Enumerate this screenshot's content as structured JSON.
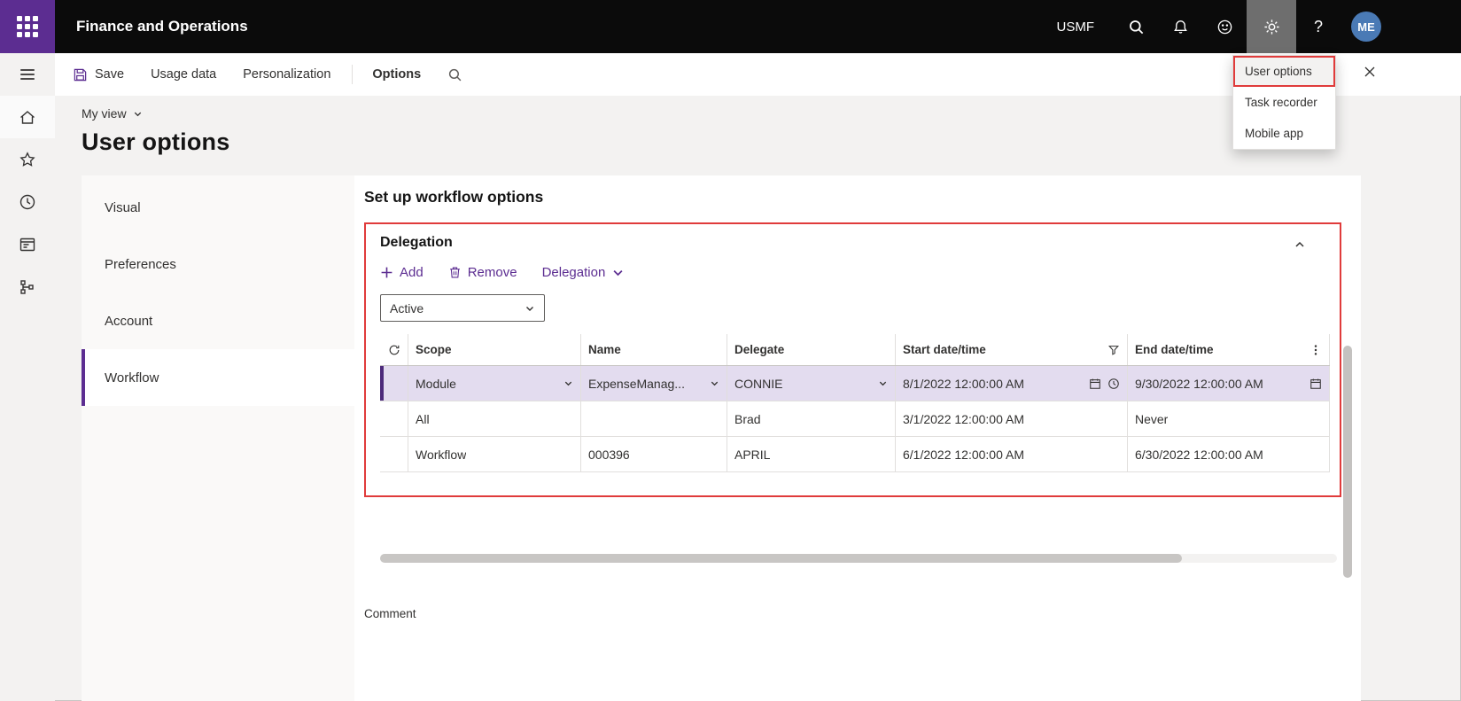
{
  "colors": {
    "accent_purple": "#5c2d91",
    "topbar_black": "#0b0b0b",
    "annotation_red": "#e03b3b",
    "selected_row_bg": "#e3dcef",
    "selected_row_bar": "#4c2a7a",
    "avatar_blue": "#4a7ab5",
    "gear_active_bg": "#6e6e6e"
  },
  "icons": {
    "app_launcher": "waffle-grid",
    "search": "magnifier",
    "notifications": "bell",
    "feedback": "smiley",
    "settings": "gear",
    "help": "question-mark",
    "close": "x",
    "navigation": "hamburger",
    "home": "house",
    "favorites": "star",
    "recent": "clock",
    "workspaces": "window",
    "modules": "hierarchy",
    "save": "floppy-disk",
    "add": "plus",
    "remove": "trash",
    "collapse": "chevron-up",
    "dropdown": "chevron-down",
    "refresh": "circular-arrow",
    "filter": "funnel",
    "more": "kebab-dots",
    "calendar": "calendar",
    "time": "clock"
  },
  "topbar": {
    "app_title": "Finance and Operations",
    "company": "USMF",
    "help_glyph": "?",
    "avatar_initials": "ME"
  },
  "action_bar": {
    "save": "Save",
    "usage_data": "Usage data",
    "personalization": "Personalization",
    "options": "Options"
  },
  "settings_menu": {
    "items": [
      "User options",
      "Task recorder",
      "Mobile app"
    ]
  },
  "page": {
    "view_selector": "My view",
    "title": "User options",
    "section_heading": "Set up workflow options",
    "comment_label": "Comment"
  },
  "nav_tabs": {
    "items": [
      "Visual",
      "Preferences",
      "Account",
      "Workflow"
    ],
    "active": "Workflow"
  },
  "delegation": {
    "title": "Delegation",
    "toolbar": {
      "add": "Add",
      "remove": "Remove",
      "menu": "Delegation"
    },
    "filter": {
      "value": "Active"
    },
    "table": {
      "columns": {
        "scope": "Scope",
        "name": "Name",
        "delegate": "Delegate",
        "start": "Start date/time",
        "end": "End date/time"
      },
      "rows": [
        {
          "scope": "Module",
          "name": "ExpenseManag...",
          "delegate": "CONNIE",
          "start": "8/1/2022 12:00:00 AM",
          "end": "9/30/2022 12:00:00 AM",
          "selected": true
        },
        {
          "scope": "All",
          "name": "",
          "delegate": "Brad",
          "start": "3/1/2022 12:00:00 AM",
          "end": "Never",
          "selected": false
        },
        {
          "scope": "Workflow",
          "name": "000396",
          "delegate": "APRIL",
          "start": "6/1/2022 12:00:00 AM",
          "end": "6/30/2022 12:00:00 AM",
          "selected": false
        }
      ]
    }
  }
}
